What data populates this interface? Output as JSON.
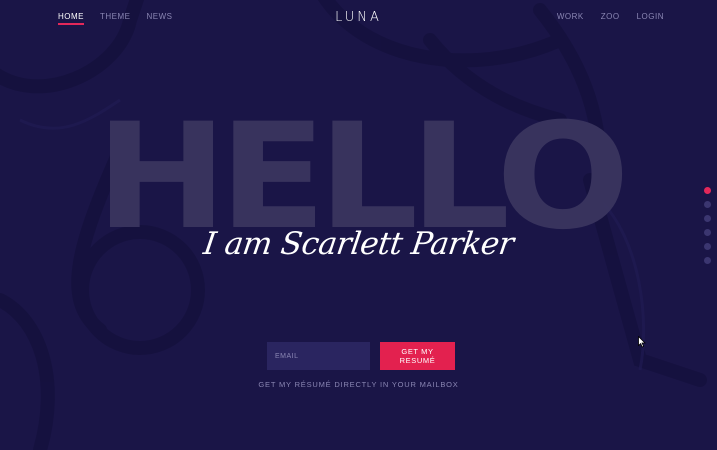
{
  "nav": {
    "left": [
      {
        "label": "HOME",
        "active": true
      },
      {
        "label": "THEME",
        "active": false
      },
      {
        "label": "NEWS",
        "active": false
      }
    ],
    "logo": "LUNA",
    "right": [
      {
        "label": "WORK"
      },
      {
        "label": "ZOO"
      },
      {
        "label": "LOGIN"
      }
    ]
  },
  "hero": {
    "headline": "HELLO",
    "subtitle": "I am Scarlett Parker"
  },
  "form": {
    "email_placeholder": "EMAIL",
    "button_label": "GET MY RESUMÉ",
    "caption": "GET MY RÉSUMÉ DIRECTLY IN YOUR MAILBOX"
  },
  "dot_nav": {
    "count": 6,
    "active_index": 0
  },
  "colors": {
    "background": "#1a1547",
    "accent": "#e3214f",
    "muted_text": "#8a86b3",
    "headline": "#3a355f",
    "input_bg": "#2a2560"
  },
  "icons": {
    "cursor": "mouse-pointer-icon"
  }
}
